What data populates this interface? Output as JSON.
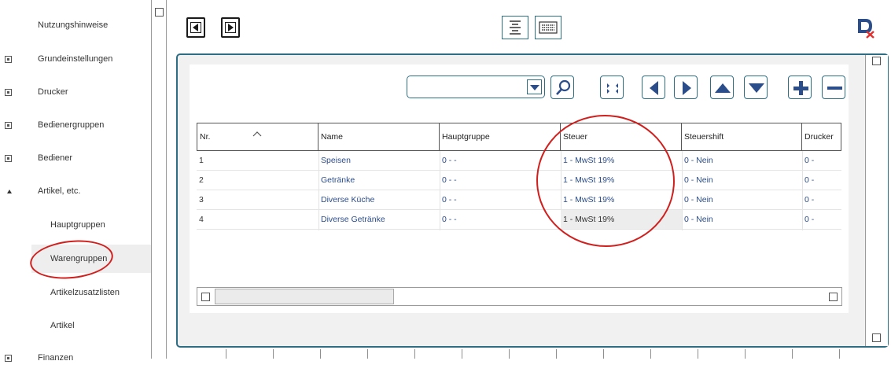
{
  "sidebar": {
    "items": [
      {
        "label": "Nutzungshinweise",
        "icon": "none"
      },
      {
        "label": "Grundeinstellungen",
        "icon": "expand-box-icon"
      },
      {
        "label": "Drucker",
        "icon": "expand-box-icon"
      },
      {
        "label": "Bedienergruppen",
        "icon": "expand-box-icon"
      },
      {
        "label": "Bediener",
        "icon": "expand-box-icon"
      },
      {
        "label": "Artikel, etc.",
        "icon": "collapse-triangle-icon"
      },
      {
        "label": "Hauptgruppen",
        "icon": "none"
      },
      {
        "label": "Warengruppen",
        "icon": "none",
        "selected": true
      },
      {
        "label": "Artikelzusatzlisten",
        "icon": "none"
      },
      {
        "label": "Artikel",
        "icon": "none"
      },
      {
        "label": "Finanzen",
        "icon": "expand-box-icon"
      }
    ]
  },
  "table": {
    "columns": [
      "Nr.",
      "Name",
      "Hauptgruppe",
      "Steuer",
      "Steuershift",
      "Drucker"
    ],
    "rows": [
      [
        "1",
        "Speisen",
        "0 - -",
        "1 - MwSt 19%",
        "0 - Nein",
        "0 -"
      ],
      [
        "2",
        "Getränke",
        "0 - -",
        "1 - MwSt 19%",
        "0 - Nein",
        "0 -"
      ],
      [
        "3",
        "Diverse Küche",
        "0 - -",
        "1 - MwSt 19%",
        "0 - Nein",
        "0 -"
      ],
      [
        "4",
        "Diverse Getränke",
        "0 - -",
        "1 - MwSt 19%",
        "0 - Nein",
        "0 -"
      ]
    ],
    "sort_column": "Nr.",
    "sort_icon": "chevron-up-icon"
  },
  "search": {
    "value": "",
    "placeholder": ""
  },
  "toolbar": {
    "icons": [
      "page-prev-icon",
      "page-next-icon",
      "list-view-icon",
      "keyboard-view-icon",
      "exit-icon"
    ],
    "nav_icons": [
      "search-icon",
      "expand-icon",
      "nav-left-icon",
      "nav-right-icon",
      "nav-up-icon",
      "nav-down-icon",
      "add-icon",
      "remove-icon"
    ]
  },
  "colors": {
    "accent": "#2e6e84",
    "icon_blue": "#2b4d8a",
    "annotation_red": "#d0201e",
    "exit_red": "#e03030"
  }
}
